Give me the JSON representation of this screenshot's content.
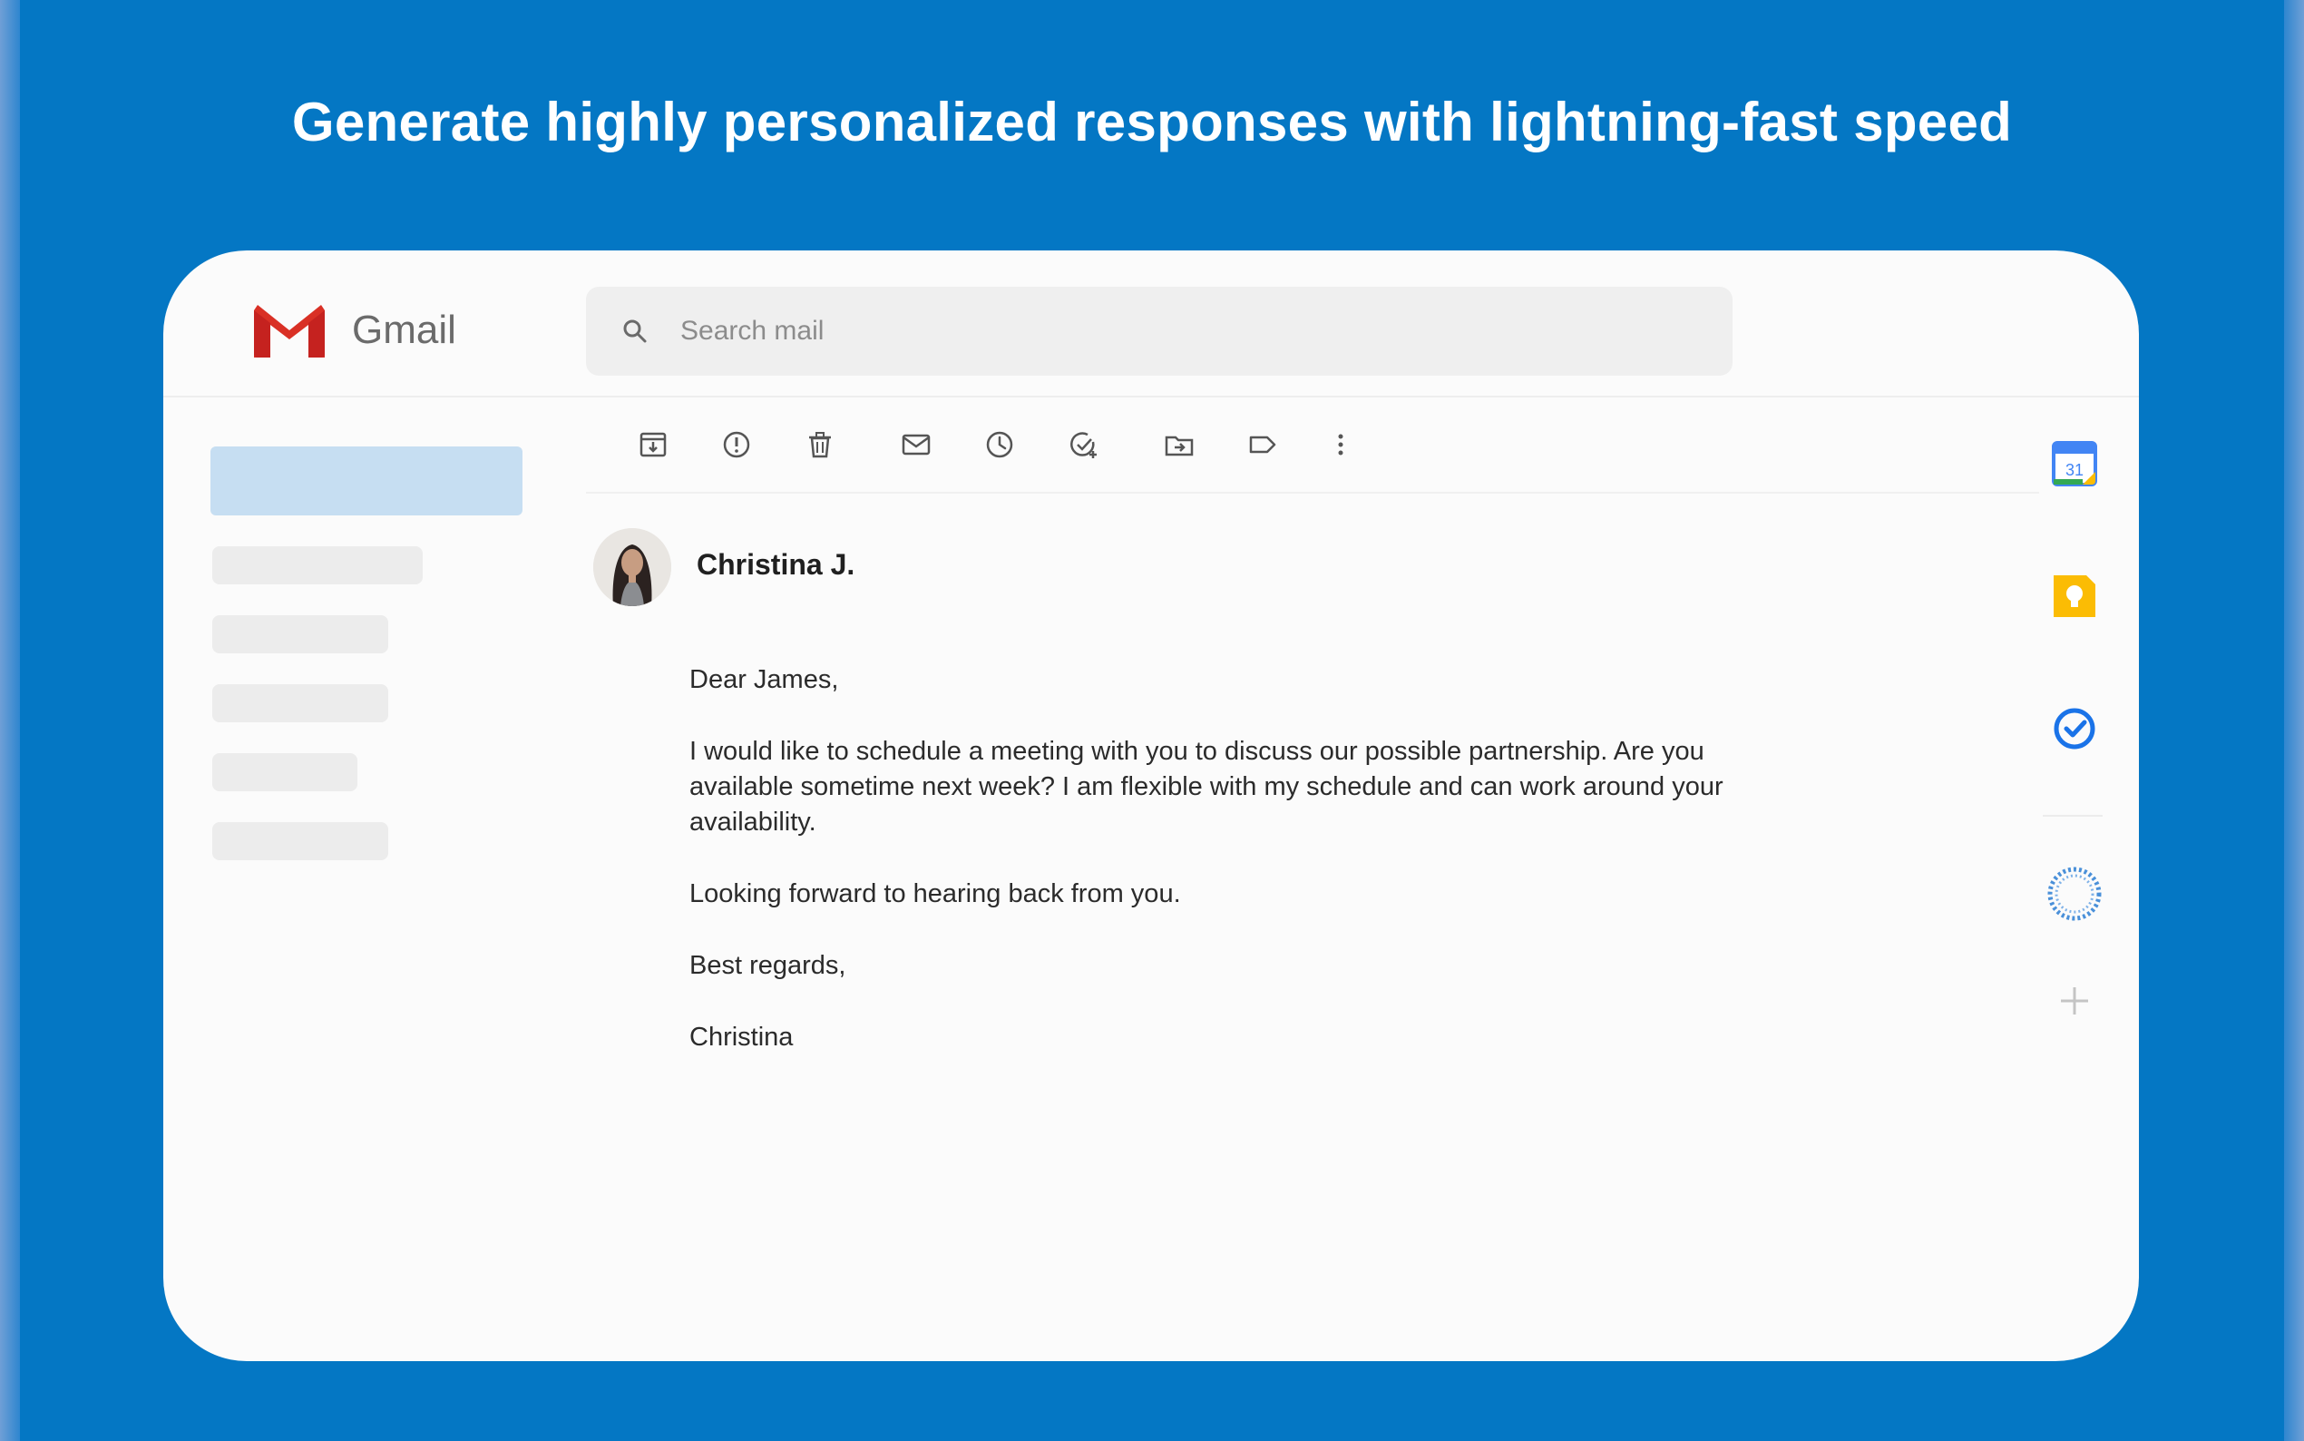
{
  "headline": "Generate highly personalized responses with lightning-fast speed",
  "app": {
    "name": "Gmail",
    "brand_colors": {
      "red": "#d93025",
      "blue": "#4285f4",
      "green": "#34a853",
      "yellow": "#fbbc04"
    }
  },
  "search": {
    "placeholder": "Search mail",
    "icon": "search-icon"
  },
  "toolbar": {
    "icons": [
      "archive-icon",
      "report-spam-icon",
      "delete-icon",
      "mark-unread-icon",
      "snooze-icon",
      "add-to-tasks-icon",
      "move-to-icon",
      "label-icon",
      "more-options-icon"
    ]
  },
  "email": {
    "sender": "Christina J.",
    "greeting": "Dear James,",
    "paragraph": "I would like to schedule a meeting with you to discuss our possible partnership. Are you available sometime next week? I am flexible with my schedule and can work around your availability.",
    "closing_line": "Looking forward to hearing back from you.",
    "signoff": "Best regards,",
    "signature": "Christina"
  },
  "right_rail": {
    "calendar_date": "31",
    "icons": [
      "calendar-icon",
      "keep-icon",
      "tasks-icon",
      "loading-spinner-icon",
      "add-icon"
    ]
  },
  "colors": {
    "background": "#0477c4",
    "sidebar_active": "#c6def2",
    "keep_yellow": "#fbbc04",
    "tasks_blue": "#1a73e8"
  }
}
